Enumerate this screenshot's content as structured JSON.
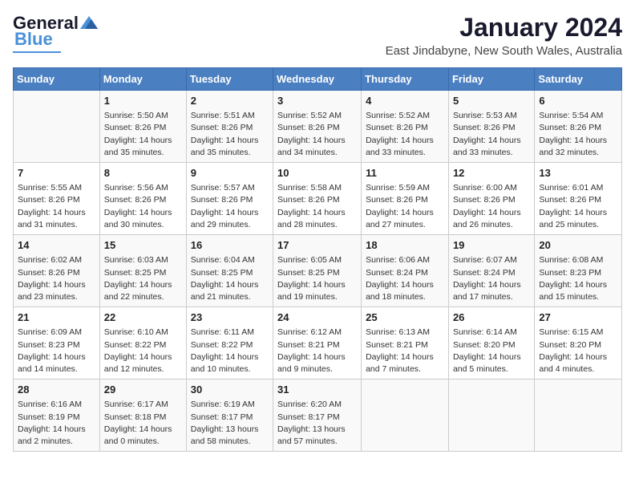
{
  "logo": {
    "line1": "General",
    "line2": "Blue"
  },
  "title": "January 2024",
  "subtitle": "East Jindabyne, New South Wales, Australia",
  "days_of_week": [
    "Sunday",
    "Monday",
    "Tuesday",
    "Wednesday",
    "Thursday",
    "Friday",
    "Saturday"
  ],
  "weeks": [
    [
      {
        "day": "",
        "content": ""
      },
      {
        "day": "1",
        "content": "Sunrise: 5:50 AM\nSunset: 8:26 PM\nDaylight: 14 hours\nand 35 minutes."
      },
      {
        "day": "2",
        "content": "Sunrise: 5:51 AM\nSunset: 8:26 PM\nDaylight: 14 hours\nand 35 minutes."
      },
      {
        "day": "3",
        "content": "Sunrise: 5:52 AM\nSunset: 8:26 PM\nDaylight: 14 hours\nand 34 minutes."
      },
      {
        "day": "4",
        "content": "Sunrise: 5:52 AM\nSunset: 8:26 PM\nDaylight: 14 hours\nand 33 minutes."
      },
      {
        "day": "5",
        "content": "Sunrise: 5:53 AM\nSunset: 8:26 PM\nDaylight: 14 hours\nand 33 minutes."
      },
      {
        "day": "6",
        "content": "Sunrise: 5:54 AM\nSunset: 8:26 PM\nDaylight: 14 hours\nand 32 minutes."
      }
    ],
    [
      {
        "day": "7",
        "content": "Sunrise: 5:55 AM\nSunset: 8:26 PM\nDaylight: 14 hours\nand 31 minutes."
      },
      {
        "day": "8",
        "content": "Sunrise: 5:56 AM\nSunset: 8:26 PM\nDaylight: 14 hours\nand 30 minutes."
      },
      {
        "day": "9",
        "content": "Sunrise: 5:57 AM\nSunset: 8:26 PM\nDaylight: 14 hours\nand 29 minutes."
      },
      {
        "day": "10",
        "content": "Sunrise: 5:58 AM\nSunset: 8:26 PM\nDaylight: 14 hours\nand 28 minutes."
      },
      {
        "day": "11",
        "content": "Sunrise: 5:59 AM\nSunset: 8:26 PM\nDaylight: 14 hours\nand 27 minutes."
      },
      {
        "day": "12",
        "content": "Sunrise: 6:00 AM\nSunset: 8:26 PM\nDaylight: 14 hours\nand 26 minutes."
      },
      {
        "day": "13",
        "content": "Sunrise: 6:01 AM\nSunset: 8:26 PM\nDaylight: 14 hours\nand 25 minutes."
      }
    ],
    [
      {
        "day": "14",
        "content": "Sunrise: 6:02 AM\nSunset: 8:26 PM\nDaylight: 14 hours\nand 23 minutes."
      },
      {
        "day": "15",
        "content": "Sunrise: 6:03 AM\nSunset: 8:25 PM\nDaylight: 14 hours\nand 22 minutes."
      },
      {
        "day": "16",
        "content": "Sunrise: 6:04 AM\nSunset: 8:25 PM\nDaylight: 14 hours\nand 21 minutes."
      },
      {
        "day": "17",
        "content": "Sunrise: 6:05 AM\nSunset: 8:25 PM\nDaylight: 14 hours\nand 19 minutes."
      },
      {
        "day": "18",
        "content": "Sunrise: 6:06 AM\nSunset: 8:24 PM\nDaylight: 14 hours\nand 18 minutes."
      },
      {
        "day": "19",
        "content": "Sunrise: 6:07 AM\nSunset: 8:24 PM\nDaylight: 14 hours\nand 17 minutes."
      },
      {
        "day": "20",
        "content": "Sunrise: 6:08 AM\nSunset: 8:23 PM\nDaylight: 14 hours\nand 15 minutes."
      }
    ],
    [
      {
        "day": "21",
        "content": "Sunrise: 6:09 AM\nSunset: 8:23 PM\nDaylight: 14 hours\nand 14 minutes."
      },
      {
        "day": "22",
        "content": "Sunrise: 6:10 AM\nSunset: 8:22 PM\nDaylight: 14 hours\nand 12 minutes."
      },
      {
        "day": "23",
        "content": "Sunrise: 6:11 AM\nSunset: 8:22 PM\nDaylight: 14 hours\nand 10 minutes."
      },
      {
        "day": "24",
        "content": "Sunrise: 6:12 AM\nSunset: 8:21 PM\nDaylight: 14 hours\nand 9 minutes."
      },
      {
        "day": "25",
        "content": "Sunrise: 6:13 AM\nSunset: 8:21 PM\nDaylight: 14 hours\nand 7 minutes."
      },
      {
        "day": "26",
        "content": "Sunrise: 6:14 AM\nSunset: 8:20 PM\nDaylight: 14 hours\nand 5 minutes."
      },
      {
        "day": "27",
        "content": "Sunrise: 6:15 AM\nSunset: 8:20 PM\nDaylight: 14 hours\nand 4 minutes."
      }
    ],
    [
      {
        "day": "28",
        "content": "Sunrise: 6:16 AM\nSunset: 8:19 PM\nDaylight: 14 hours\nand 2 minutes."
      },
      {
        "day": "29",
        "content": "Sunrise: 6:17 AM\nSunset: 8:18 PM\nDaylight: 14 hours\nand 0 minutes."
      },
      {
        "day": "30",
        "content": "Sunrise: 6:19 AM\nSunset: 8:17 PM\nDaylight: 13 hours\nand 58 minutes."
      },
      {
        "day": "31",
        "content": "Sunrise: 6:20 AM\nSunset: 8:17 PM\nDaylight: 13 hours\nand 57 minutes."
      },
      {
        "day": "",
        "content": ""
      },
      {
        "day": "",
        "content": ""
      },
      {
        "day": "",
        "content": ""
      }
    ]
  ]
}
